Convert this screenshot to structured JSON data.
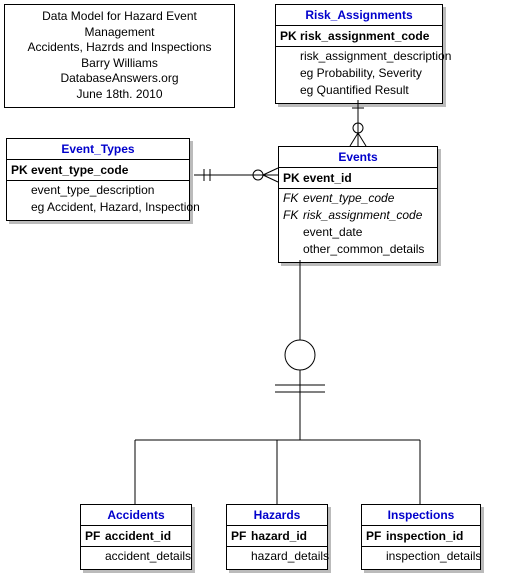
{
  "info": {
    "line1": "Data Model for Hazard Event Management",
    "line2": "Accidents, Hazrds and Inspections",
    "line3": "Barry Williams",
    "line4": "DatabaseAnswers.org",
    "line5": "June 18th. 2010"
  },
  "entities": {
    "risk": {
      "title": "Risk_Assignments",
      "pk_key": "PK",
      "pk_attr": "risk_assignment_code",
      "a1": "risk_assignment_description",
      "a2": "eg Probability, Severity",
      "a3": "eg Quantified Result"
    },
    "event_types": {
      "title": "Event_Types",
      "pk_key": "PK",
      "pk_attr": "event_type_code",
      "a1": "event_type_description",
      "a2": "eg Accident, Hazard, Inspection"
    },
    "events": {
      "title": "Events",
      "pk_key": "PK",
      "pk_attr": "event_id",
      "fk1_key": "FK",
      "fk1_attr": "event_type_code",
      "fk2_key": "FK",
      "fk2_attr": "risk_assignment_code",
      "a1": "event_date",
      "a2": "other_common_details"
    },
    "accidents": {
      "title": "Accidents",
      "pk_key": "PF",
      "pk_attr": "accident_id",
      "a1": "accident_details"
    },
    "hazards": {
      "title": "Hazards",
      "pk_key": "PF",
      "pk_attr": "hazard_id",
      "a1": "hazard_details"
    },
    "inspections": {
      "title": "Inspections",
      "pk_key": "PF",
      "pk_attr": "inspection_id",
      "a1": "inspection_details"
    }
  }
}
